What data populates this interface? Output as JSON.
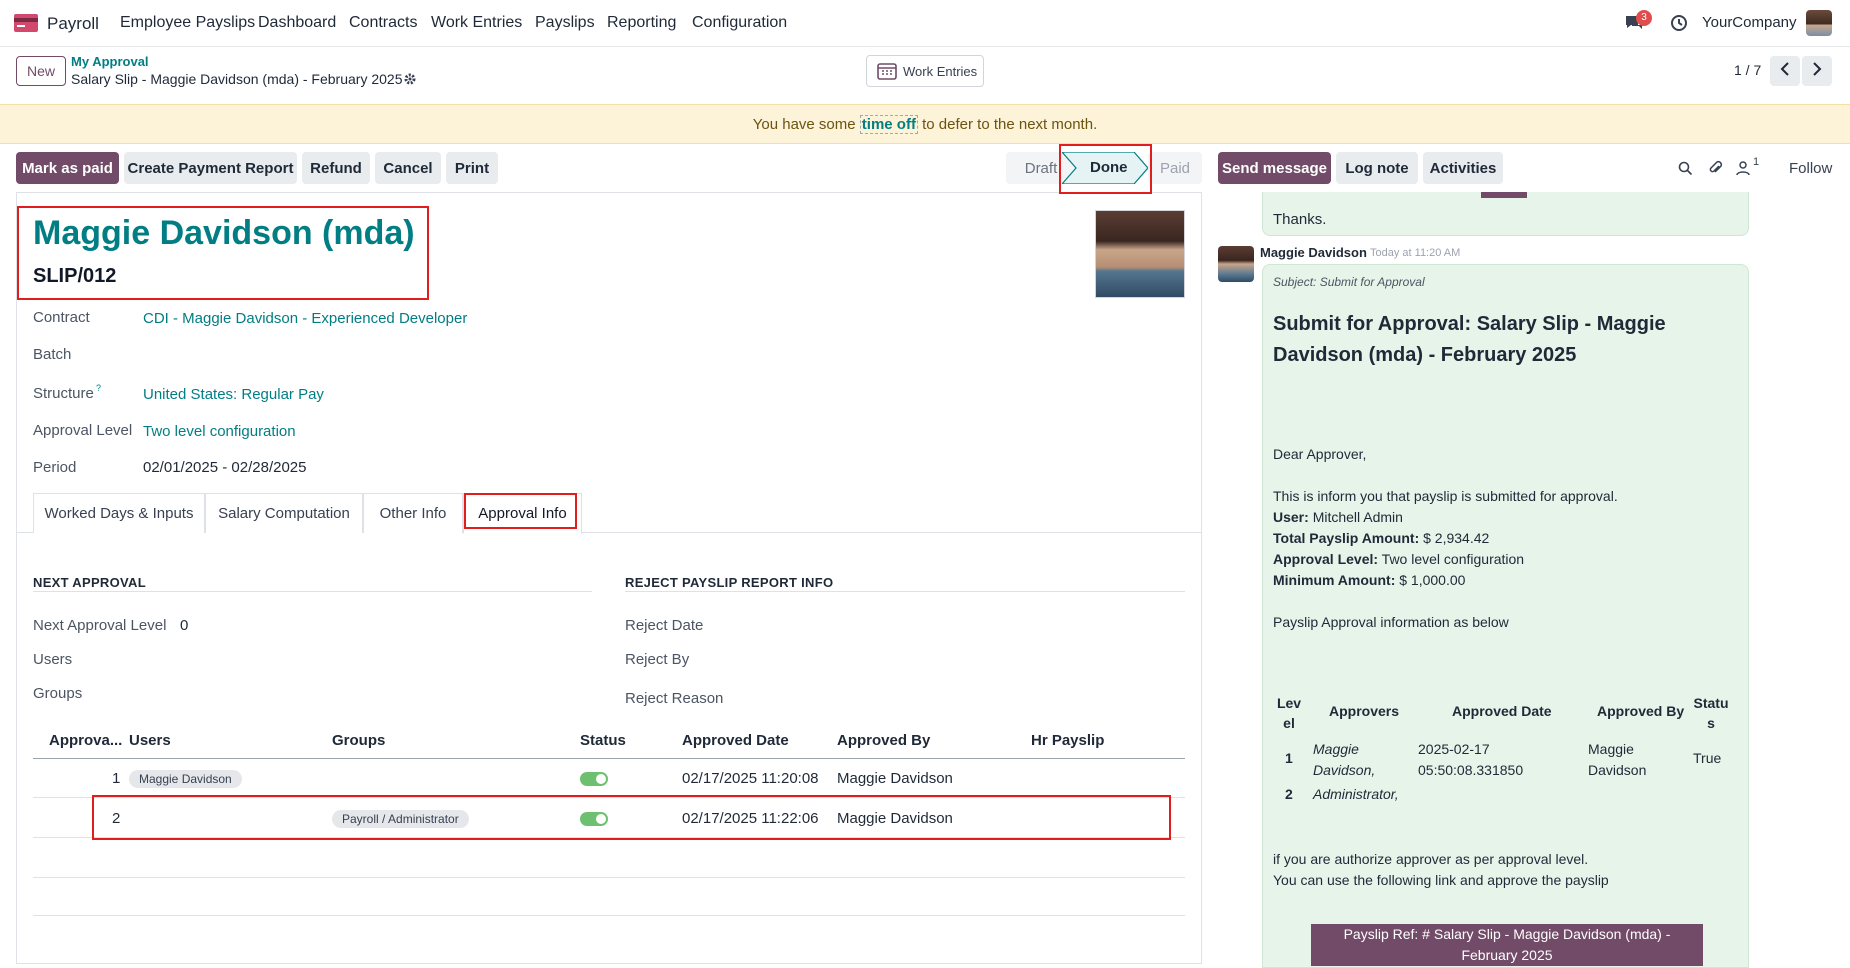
{
  "nav": {
    "app_name": "Payroll",
    "menu": [
      "Employee Payslips",
      "Dashboard",
      "Contracts",
      "Work Entries",
      "Payslips",
      "Reporting",
      "Configuration"
    ],
    "chat_badge": "3",
    "company": "YourCompany"
  },
  "control": {
    "new_label": "New",
    "breadcrumb_parent": "My Approval",
    "breadcrumb_current": "Salary Slip - Maggie Davidson (mda) - February 2025",
    "work_entries_label": "Work Entries",
    "pager": "1 / 7"
  },
  "alert": {
    "before": "You have some",
    "link": "time off",
    "after": "to defer to the next month."
  },
  "actions": {
    "mark_paid": "Mark as paid",
    "create_report": "Create Payment Report",
    "refund": "Refund",
    "cancel": "Cancel",
    "print": "Print"
  },
  "statusbar": {
    "draft": "Draft",
    "done": "Done",
    "paid": "Paid"
  },
  "chatter_actions": {
    "send_message": "Send message",
    "log_note": "Log note",
    "activities": "Activities",
    "followers_count": "1",
    "follow": "Follow"
  },
  "form": {
    "employee_name": "Maggie Davidson (mda)",
    "slip_number": "SLIP/012",
    "contract_label": "Contract",
    "contract_value": "CDI - Maggie Davidson - Experienced Developer",
    "batch_label": "Batch",
    "structure_label": "Structure",
    "structure_help": "?",
    "structure_value": "United States: Regular Pay",
    "approval_level_label": "Approval Level",
    "approval_level_value": "Two level configuration",
    "period_label": "Period",
    "period_value": "02/01/2025 - 02/28/2025"
  },
  "tabs": [
    "Worked Days & Inputs",
    "Salary Computation",
    "Other Info",
    "Approval Info"
  ],
  "approval": {
    "next_title": "NEXT APPROVAL",
    "next_level_label": "Next Approval Level",
    "next_level_value": "0",
    "users_label": "Users",
    "groups_label": "Groups",
    "reject_title": "REJECT PAYSLIP REPORT INFO",
    "reject_date_label": "Reject Date",
    "reject_by_label": "Reject By",
    "reject_reason_label": "Reject Reason"
  },
  "table": {
    "headers": [
      "Approva...",
      "Users",
      "Groups",
      "Status",
      "Approved Date",
      "Approved By",
      "Hr Payslip"
    ],
    "rows": [
      {
        "level": "1",
        "user": "Maggie Davidson",
        "group": "",
        "status": true,
        "date": "02/17/2025 11:20:08",
        "by": "Maggie Davidson"
      },
      {
        "level": "2",
        "user": "",
        "group": "Payroll / Administrator",
        "status": true,
        "date": "02/17/2025 11:22:06",
        "by": "Maggie Davidson"
      }
    ]
  },
  "chatter": {
    "thanks": "Thanks.",
    "author": "Maggie Davidson",
    "time": "Today at 11:20 AM",
    "subject": "Subject: Submit for Approval",
    "heading": "Submit for Approval: Salary Slip - Maggie Davidson (mda) - February 2025",
    "greeting": "Dear Approver,",
    "intro": "This is inform you that payslip is submitted for approval.",
    "user_label": "User:",
    "user_value": "Mitchell Admin",
    "amount_label": "Total Payslip Amount:",
    "amount_value": "$ 2,934.42",
    "level_label": "Approval Level:",
    "level_value": "Two level configuration",
    "min_label": "Minimum Amount:",
    "min_value": "$ 1,000.00",
    "info_line": "Payslip Approval information as below",
    "tbl_headers": [
      "Level",
      "Approvers",
      "Approved Date",
      "Approved By",
      "Status"
    ],
    "tbl_rows": [
      {
        "level": "1",
        "approvers": "Maggie Davidson,",
        "date": "2025-02-17 05:50:08.331850",
        "by": "Maggie Davidson",
        "status": "True"
      },
      {
        "level": "2",
        "approvers": "Administrator,",
        "date": "",
        "by": "",
        "status": ""
      }
    ],
    "closing1": "if you are authorize approver as per approval level.",
    "closing2": "You can use the following link and approve the payslip",
    "ref_button": "Payslip Ref: # Salary Slip - Maggie Davidson (mda) - February 2025"
  },
  "colors": {
    "brand": "#714b67",
    "link": "#017e84",
    "alert_bg": "#fdf3d9",
    "chat_bg": "#e6f4ea",
    "highlight": "#e01e1e"
  }
}
